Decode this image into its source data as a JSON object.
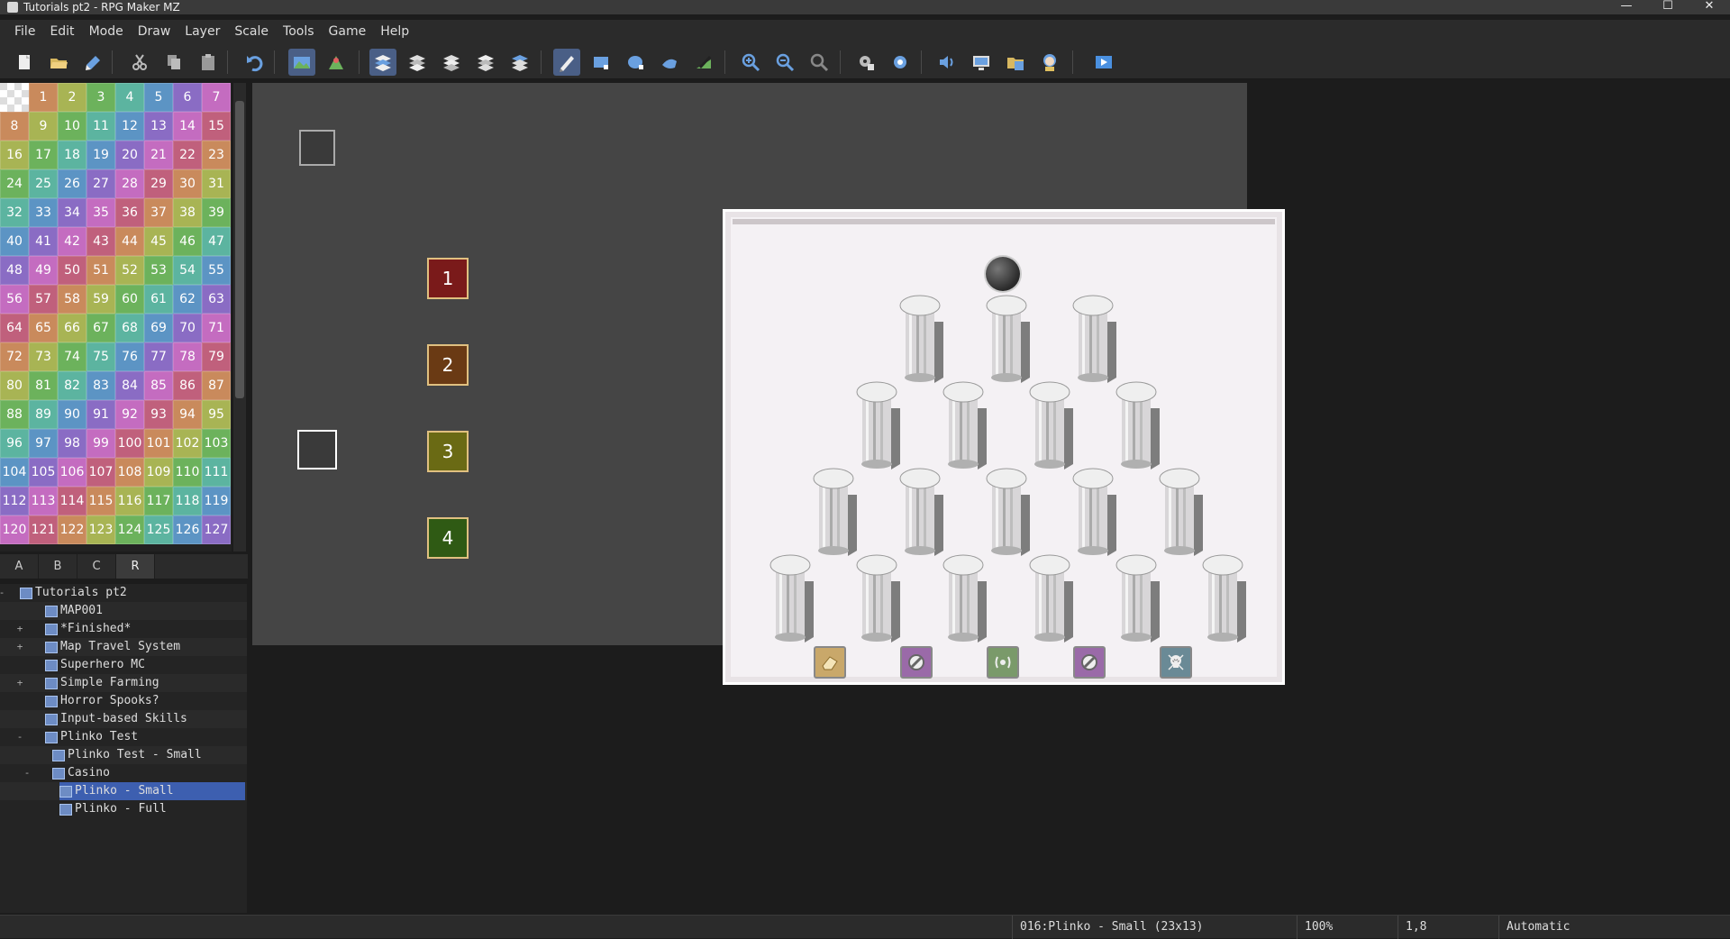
{
  "window": {
    "title": "Tutorials pt2 - RPG Maker MZ",
    "minimize": "—",
    "maximize": "☐",
    "close": "✕"
  },
  "menu": [
    "File",
    "Edit",
    "Mode",
    "Draw",
    "Layer",
    "Scale",
    "Tools",
    "Game",
    "Help"
  ],
  "toolbar": {
    "buttons": [
      {
        "name": "new-project-icon",
        "active": false
      },
      {
        "name": "open-project-icon",
        "active": false
      },
      {
        "name": "save-project-icon",
        "active": false
      },
      {
        "name": "cut-icon",
        "active": false
      },
      {
        "name": "copy-icon",
        "active": false
      },
      {
        "name": "paste-icon",
        "active": false
      },
      {
        "name": "undo-icon",
        "active": false
      },
      {
        "name": "map-mode-icon",
        "active": true
      },
      {
        "name": "event-mode-icon",
        "active": false
      },
      {
        "name": "layer-auto-icon",
        "active": true
      },
      {
        "name": "layer-1-icon",
        "active": false
      },
      {
        "name": "layer-2-icon",
        "active": false
      },
      {
        "name": "layer-3-icon",
        "active": false
      },
      {
        "name": "layer-4-icon",
        "active": false
      },
      {
        "name": "pencil-icon",
        "active": true
      },
      {
        "name": "rectangle-icon",
        "active": false
      },
      {
        "name": "ellipse-icon",
        "active": false
      },
      {
        "name": "flood-fill-icon",
        "active": false
      },
      {
        "name": "shadow-pen-icon",
        "active": false
      },
      {
        "name": "zoom-in-icon",
        "active": false
      },
      {
        "name": "zoom-out-icon",
        "active": false
      },
      {
        "name": "zoom-actual-icon",
        "active": false
      },
      {
        "name": "database-icon",
        "active": false
      },
      {
        "name": "plugin-manager-icon",
        "active": false
      },
      {
        "name": "sound-test-icon",
        "active": false
      },
      {
        "name": "event-searcher-icon",
        "active": false
      },
      {
        "name": "resource-manager-icon",
        "active": false
      },
      {
        "name": "character-generator-icon",
        "active": false
      },
      {
        "name": "playtest-icon",
        "active": false
      }
    ]
  },
  "palette": {
    "numbers": [
      "1",
      "2",
      "3",
      "4",
      "5",
      "6",
      "7",
      "8",
      "9",
      "10",
      "11",
      "12",
      "13",
      "14",
      "15",
      "16",
      "17",
      "18",
      "19",
      "20",
      "21",
      "22",
      "23",
      "24",
      "25",
      "26",
      "27",
      "28",
      "29",
      "30",
      "31",
      "32",
      "33",
      "34",
      "35",
      "36",
      "37",
      "38",
      "39",
      "40",
      "41",
      "42",
      "43",
      "44",
      "45",
      "46",
      "47",
      "48",
      "49",
      "50",
      "51",
      "52",
      "53",
      "54",
      "55",
      "56",
      "57",
      "58",
      "59",
      "60",
      "61",
      "62",
      "63",
      "64",
      "65",
      "66",
      "67",
      "68",
      "69",
      "70",
      "71",
      "72",
      "73",
      "74",
      "75",
      "76",
      "77",
      "78",
      "79",
      "80",
      "81",
      "82",
      "83",
      "84",
      "85",
      "86",
      "87",
      "88",
      "89",
      "90",
      "91",
      "92",
      "93",
      "94",
      "95",
      "96",
      "97",
      "98",
      "99",
      "100",
      "101",
      "102",
      "103",
      "104",
      "105",
      "106",
      "107",
      "108",
      "109",
      "110",
      "111",
      "112",
      "113",
      "114",
      "115",
      "116",
      "117",
      "118",
      "119",
      "120",
      "121",
      "122",
      "123",
      "124",
      "125",
      "126",
      "127"
    ],
    "colors": [
      "#c0607c",
      "#c98a5c",
      "#a8b454",
      "#6cb25c",
      "#5cb4a0",
      "#5c94c4",
      "#8a6cc4",
      "#c46cc0"
    ]
  },
  "tabs": [
    "A",
    "B",
    "C",
    "R"
  ],
  "tree": [
    {
      "label": "Tutorials pt2",
      "level": 0,
      "exp": "-"
    },
    {
      "label": "MAP001",
      "level": 1,
      "exp": ""
    },
    {
      "label": "*Finished*",
      "level": 1,
      "exp": "+"
    },
    {
      "label": "Map Travel System",
      "level": 1,
      "exp": "+"
    },
    {
      "label": "Superhero MC",
      "level": 1,
      "exp": ""
    },
    {
      "label": "Simple Farming",
      "level": 1,
      "exp": "+"
    },
    {
      "label": "Horror Spooks?",
      "level": 1,
      "exp": ""
    },
    {
      "label": "Input-based Skills",
      "level": 1,
      "exp": ""
    },
    {
      "label": "Plinko Test",
      "level": 1,
      "exp": "-"
    },
    {
      "label": "Plinko Test - Small",
      "level": 2,
      "exp": ""
    },
    {
      "label": "Casino",
      "level": 2,
      "exp": "-"
    },
    {
      "label": "Plinko - Small",
      "level": 3,
      "exp": "",
      "selected": true
    },
    {
      "label": "Plinko - Full",
      "level": 3,
      "exp": ""
    }
  ],
  "map": {
    "number_tiles": [
      {
        "label": "1",
        "color": "#7a1a1a"
      },
      {
        "label": "2",
        "color": "#6a3a14"
      },
      {
        "label": "3",
        "color": "#6a6a14"
      },
      {
        "label": "4",
        "color": "#2f5a14"
      }
    ],
    "slots": [
      {
        "icon": "eraser-icon",
        "color": "#c9a86a"
      },
      {
        "icon": "no-entry-icon",
        "color": "#9a6aa8"
      },
      {
        "icon": "radiation-icon",
        "color": "#7a9a6a"
      },
      {
        "icon": "no-entry-icon",
        "color": "#9a6aa8"
      },
      {
        "icon": "skull-icon",
        "color": "#6a8a96"
      }
    ]
  },
  "status": {
    "map_info": "016:Plinko - Small (23x13)",
    "zoom": "100%",
    "coords": "1,8",
    "scale_mode": "Automatic"
  }
}
